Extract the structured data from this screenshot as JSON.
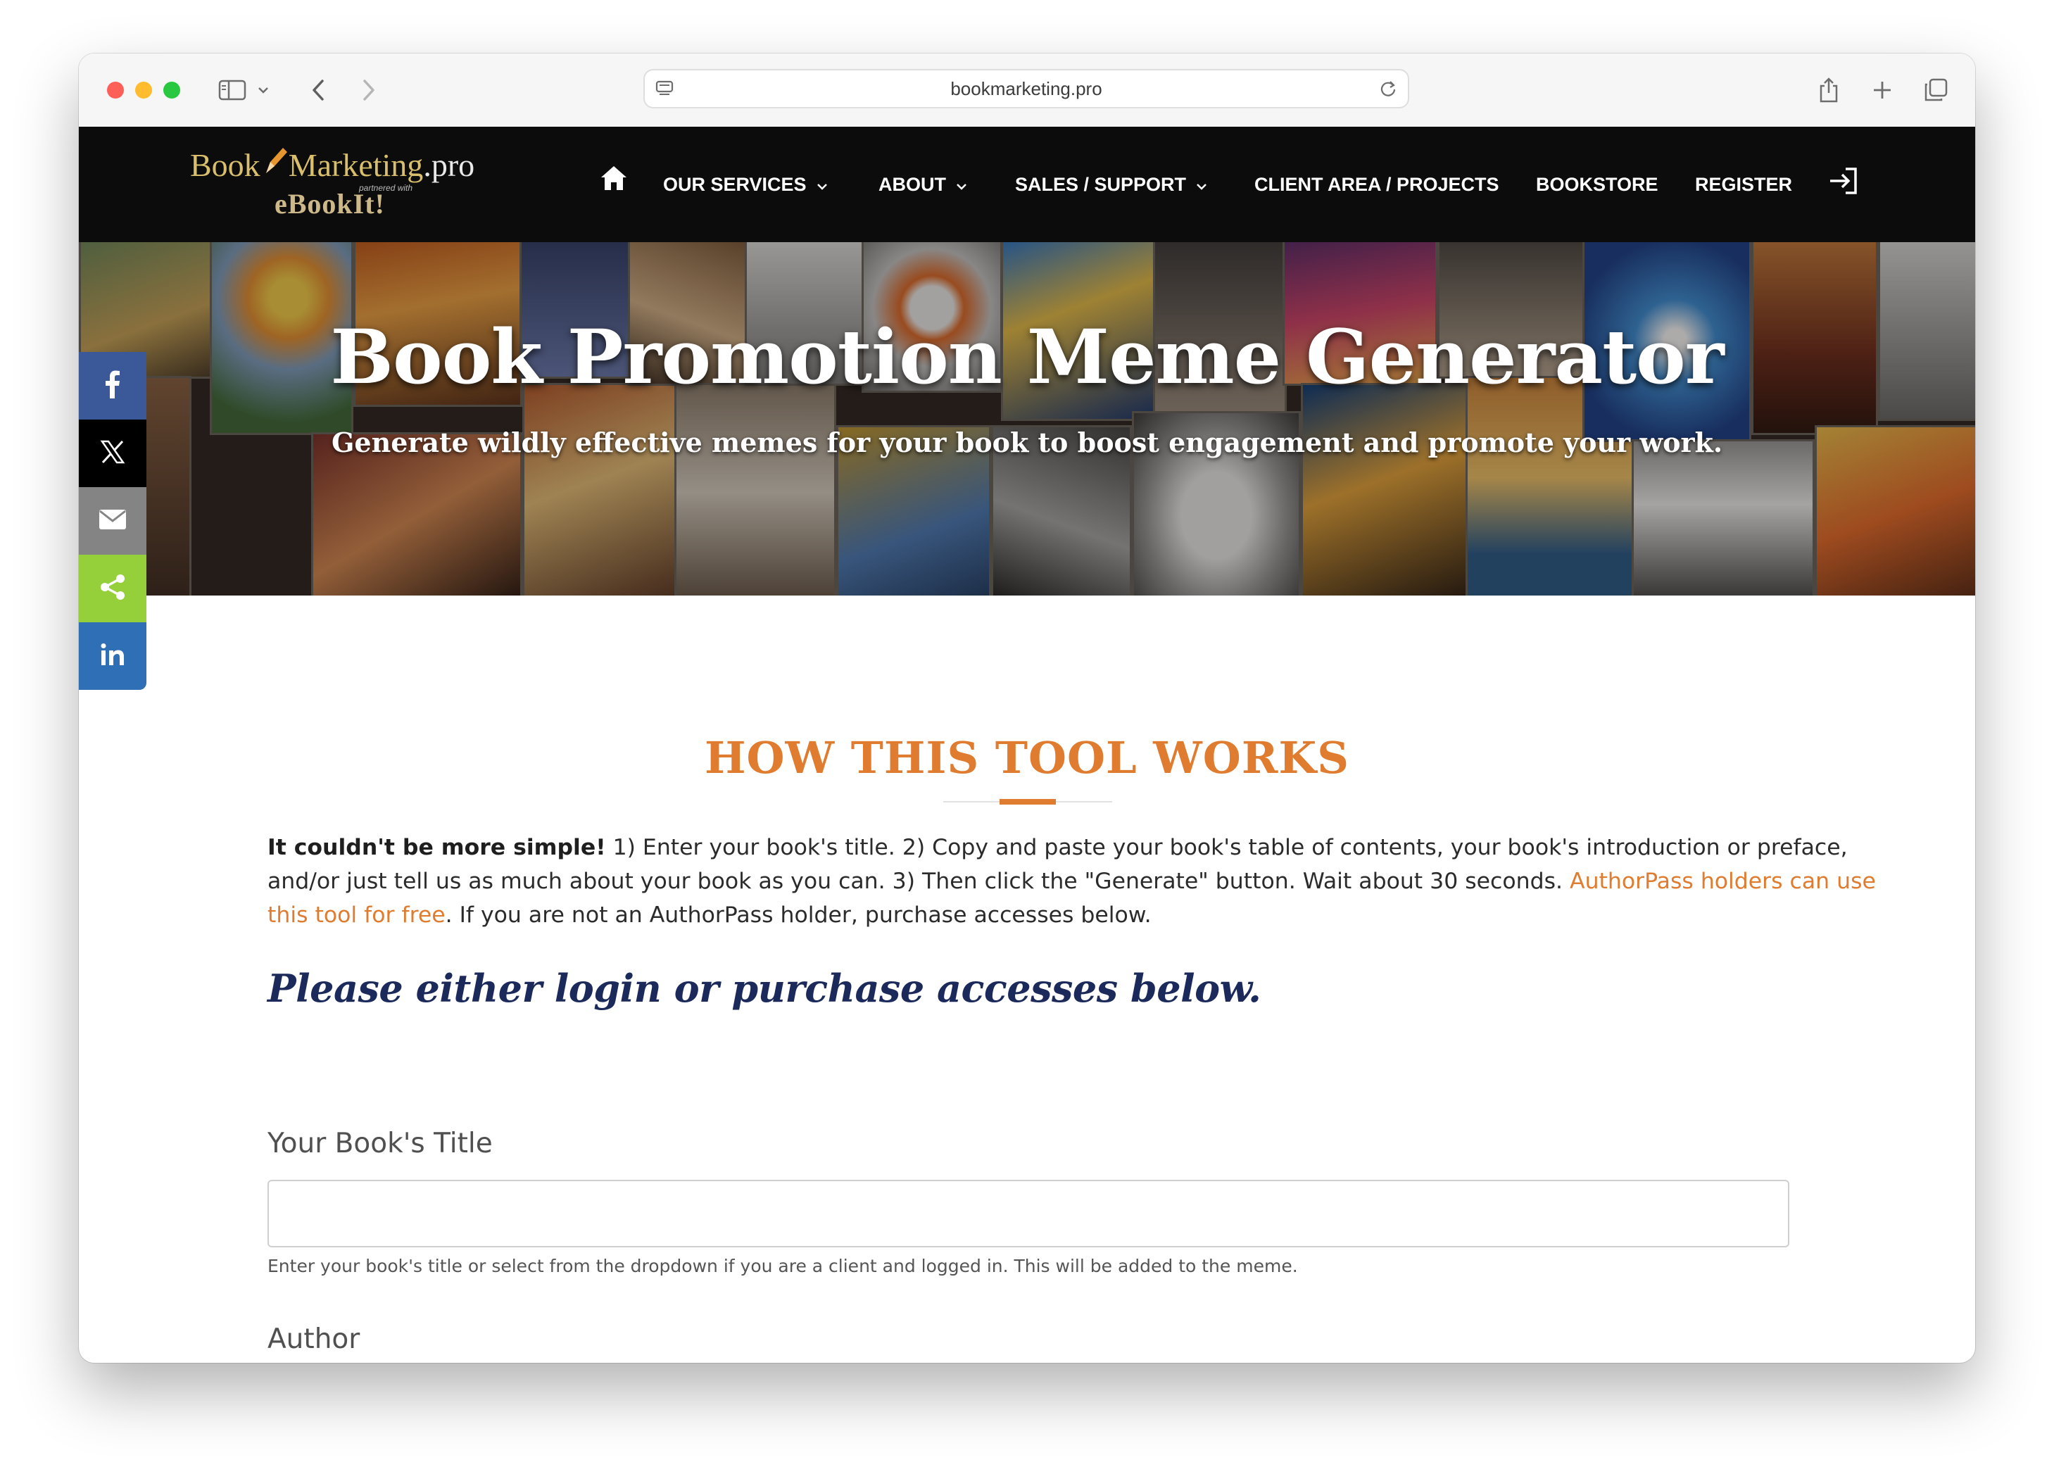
{
  "browser": {
    "url": "bookmarketing.pro"
  },
  "logo": {
    "line1_book": "Book",
    "line1_marketing": "Marketing",
    "line1_pro": ".pro",
    "partnered": "partnered with",
    "line2": "eBookIt!"
  },
  "nav": {
    "items": [
      {
        "label": "OUR SERVICES",
        "dropdown": true
      },
      {
        "label": "ABOUT",
        "dropdown": true
      },
      {
        "label": "SALES / SUPPORT",
        "dropdown": true
      },
      {
        "label": "CLIENT AREA / PROJECTS",
        "dropdown": false
      },
      {
        "label": "BOOKSTORE",
        "dropdown": false
      },
      {
        "label": "REGISTER",
        "dropdown": false
      }
    ]
  },
  "hero": {
    "title": "Book Promotion Meme Generator",
    "subtitle": "Generate wildly effective memes for your book to boost engagement and promote your work."
  },
  "share": {
    "buttons": [
      {
        "name": "facebook",
        "color": "#3b5998",
        "icon": "facebook-icon"
      },
      {
        "name": "x",
        "color": "#000000",
        "icon": "x-icon"
      },
      {
        "name": "email",
        "color": "#848484",
        "icon": "email-icon"
      },
      {
        "name": "share",
        "color": "#95d03a",
        "icon": "share-icon"
      },
      {
        "name": "linkedin",
        "color": "#0077b5",
        "icon": "linkedin-icon"
      }
    ]
  },
  "content": {
    "section_title": "HOW THIS TOOL WORKS",
    "intro_bold": "It couldn't be more simple!",
    "intro_text": " 1) Enter your book's title. 2) Copy and paste your book's table of contents, your book's introduction or preface, and/or just tell us as much about your book as you can. 3) Then click the \"Generate\" button. Wait about 30 seconds. ",
    "intro_link": "AuthorPass holders can use this tool for free",
    "intro_tail": ". If you are not an AuthorPass holder, purchase accesses below.",
    "prompt": "Please either login or purchase accesses below."
  },
  "form": {
    "title_label": "Your Book's Title",
    "title_value": "",
    "title_helper": "Enter your book's title or select from the dropdown if you are a client and logged in. This will be added to the meme.",
    "author_label": "Author"
  },
  "colors": {
    "accent": "#e07c2f",
    "prompt": "#1b2a5a",
    "nav_bg": "#0c0c0c"
  }
}
